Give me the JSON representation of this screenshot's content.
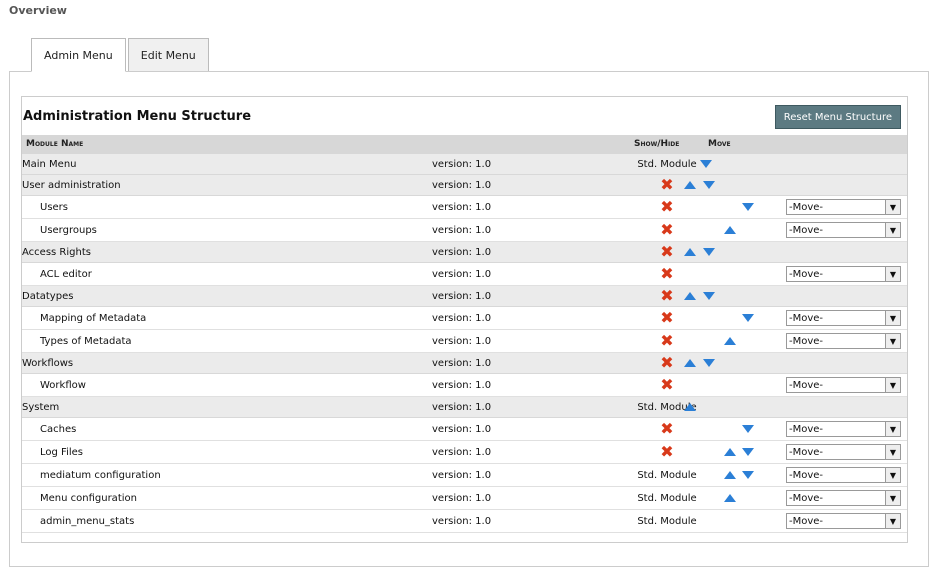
{
  "page": {
    "overview": "Overview"
  },
  "tabs": [
    {
      "label": "Admin Menu"
    },
    {
      "label": "Edit Menu"
    }
  ],
  "panel": {
    "title": "Administration Menu Structure",
    "reset_label": "Reset Menu Structure"
  },
  "columns": {
    "name": "Module Name",
    "show": "Show/Hide",
    "move": "Move"
  },
  "rows": [
    {
      "name": "Main Menu",
      "version": "version: 1.0",
      "show": "Std. Module",
      "level": 0
    },
    {
      "name": "User administration",
      "version": "version: 1.0",
      "show": "",
      "level": 0
    },
    {
      "name": "Users",
      "version": "version: 1.0",
      "show": "",
      "level": 1,
      "select": "-Move-"
    },
    {
      "name": "Usergroups",
      "version": "version: 1.0",
      "show": "",
      "level": 1,
      "select": "-Move-"
    },
    {
      "name": "Access Rights",
      "version": "version: 1.0",
      "show": "",
      "level": 0
    },
    {
      "name": "ACL editor",
      "version": "version: 1.0",
      "show": "",
      "level": 1,
      "select": "-Move-"
    },
    {
      "name": "Datatypes",
      "version": "version: 1.0",
      "show": "",
      "level": 0
    },
    {
      "name": "Mapping of Metadata",
      "version": "version: 1.0",
      "show": "",
      "level": 1,
      "select": "-Move-"
    },
    {
      "name": "Types of Metadata",
      "version": "version: 1.0",
      "show": "",
      "level": 1,
      "select": "-Move-"
    },
    {
      "name": "Workflows",
      "version": "version: 1.0",
      "show": "",
      "level": 0
    },
    {
      "name": "Workflow",
      "version": "version: 1.0",
      "show": "",
      "level": 1,
      "select": "-Move-"
    },
    {
      "name": "System",
      "version": "version: 1.0",
      "show": "Std. Module",
      "level": 0
    },
    {
      "name": "Caches",
      "version": "version: 1.0",
      "show": "",
      "level": 1,
      "select": "-Move-"
    },
    {
      "name": "Log Files",
      "version": "version: 1.0",
      "show": "",
      "level": 1,
      "select": "-Move-"
    },
    {
      "name": "mediatum configuration",
      "version": "version: 1.0",
      "show": "Std. Module",
      "level": 1,
      "select": "-Move-"
    },
    {
      "name": "Menu configuration",
      "version": "version: 1.0",
      "show": "Std. Module",
      "level": 1,
      "select": "-Move-"
    },
    {
      "name": "admin_menu_stats",
      "version": "version: 1.0",
      "show": "Std. Module",
      "level": 1,
      "select": "-Move-"
    }
  ]
}
